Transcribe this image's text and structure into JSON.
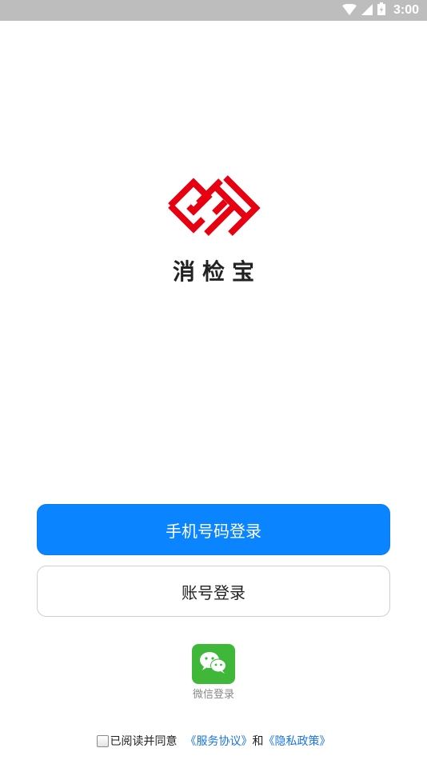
{
  "status_bar": {
    "time": "3:00"
  },
  "app": {
    "name": "消检宝",
    "brand_color": "#e60012"
  },
  "buttons": {
    "phone_login": "手机号码登录",
    "account_login": "账号登录",
    "wechat_login": "微信登录"
  },
  "agreement": {
    "prefix": "已阅读并同意",
    "terms_link": "《服务协议》",
    "conjunction": "和",
    "privacy_link": "《隐私政策》",
    "checked": false
  },
  "colors": {
    "primary": "#0a84ff",
    "wechat": "#3fb83a",
    "link": "#1a73e8"
  }
}
